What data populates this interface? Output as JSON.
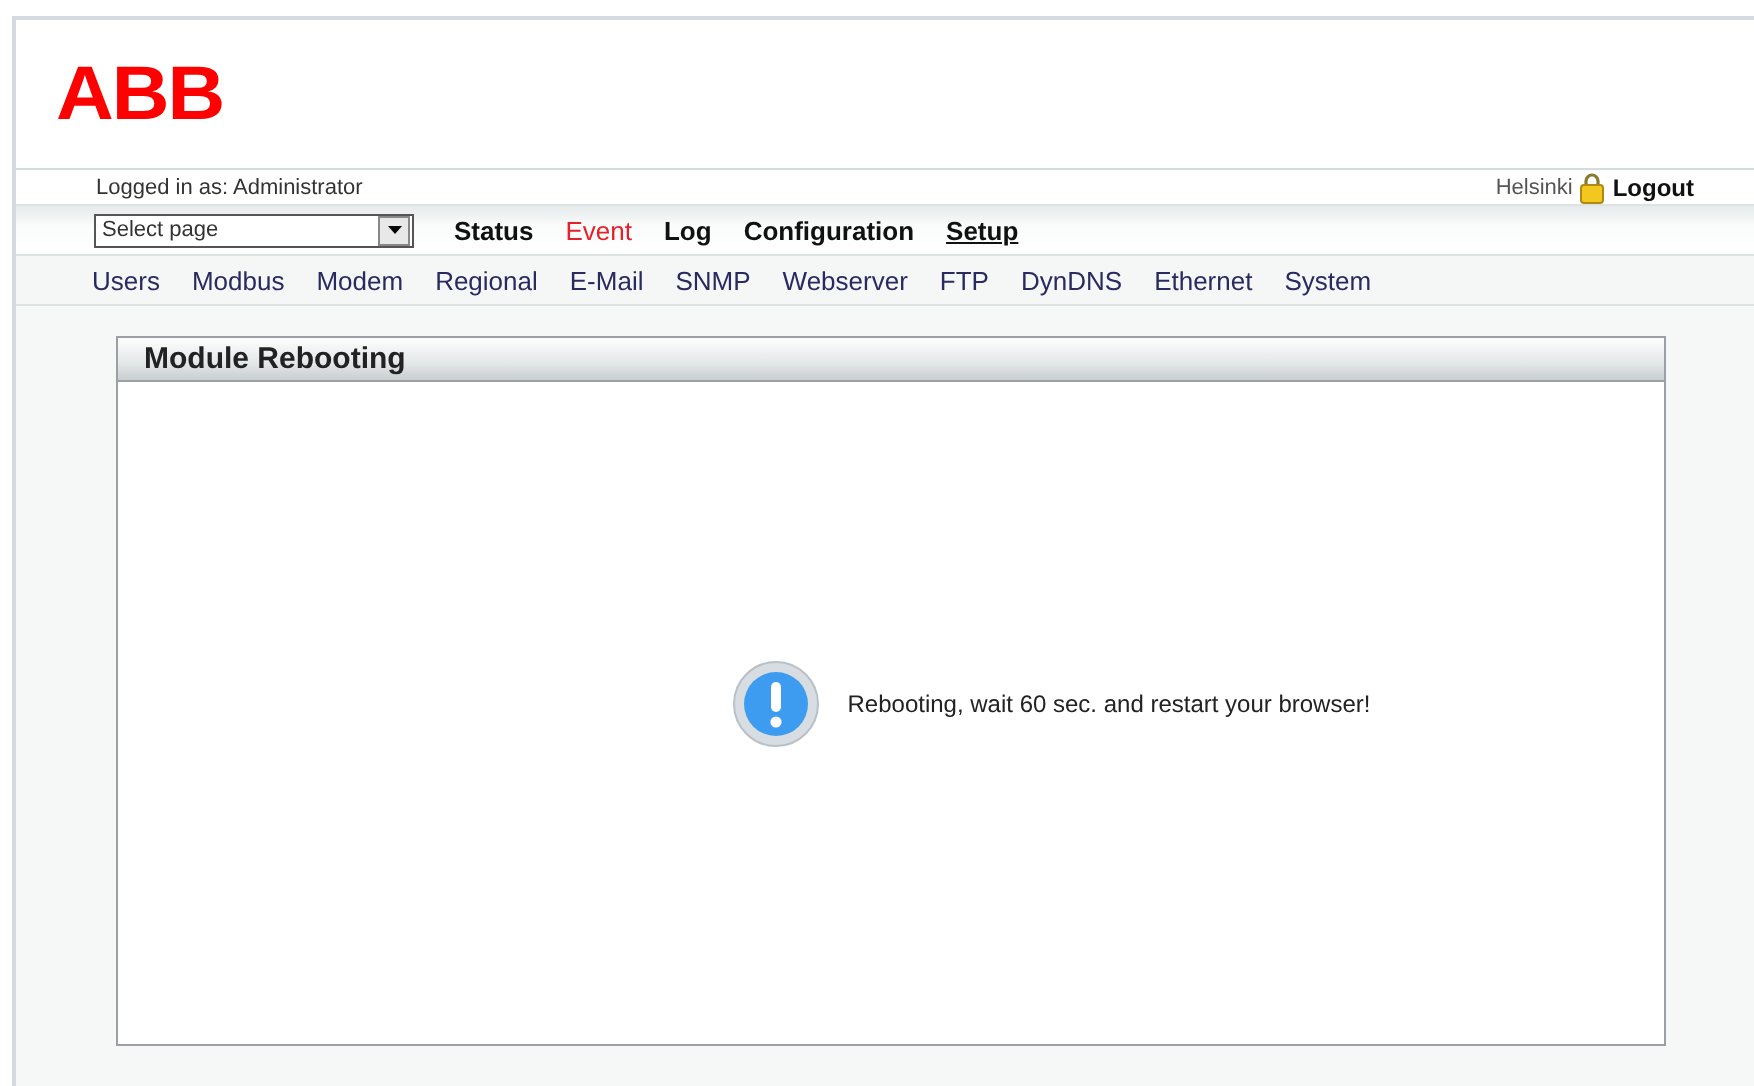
{
  "logo": "ABB",
  "user_line": "Logged in as: Administrator",
  "location": "Helsinki",
  "logout": "Logout",
  "page_select": {
    "value": "Select page"
  },
  "main_nav": [
    {
      "label": "Status",
      "selected": false,
      "alert": false
    },
    {
      "label": "Event",
      "selected": false,
      "alert": true
    },
    {
      "label": "Log",
      "selected": false,
      "alert": false
    },
    {
      "label": "Configuration",
      "selected": false,
      "alert": false
    },
    {
      "label": "Setup",
      "selected": true,
      "alert": false
    }
  ],
  "sub_nav": [
    "Users",
    "Modbus",
    "Modem",
    "Regional",
    "E-Mail",
    "SNMP",
    "Webserver",
    "FTP",
    "DynDNS",
    "Ethernet",
    "System"
  ],
  "panel": {
    "title": "Module Rebooting",
    "message": "Rebooting, wait 60 sec. and restart your browser!"
  }
}
